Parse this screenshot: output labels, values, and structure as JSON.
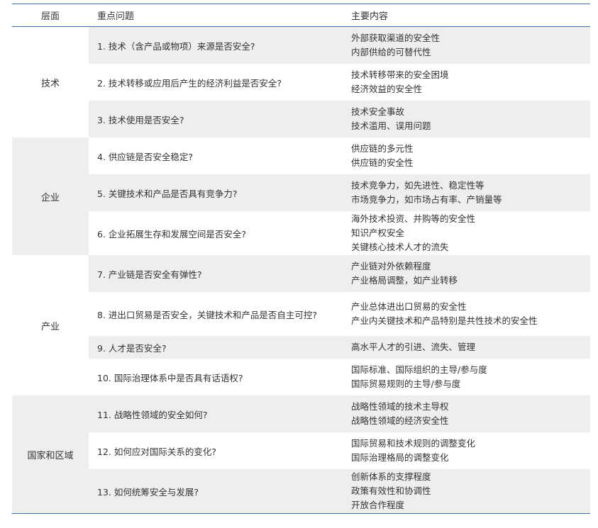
{
  "header": {
    "level": "层面",
    "question": "重点问题",
    "content": "主要内容"
  },
  "groups": [
    {
      "level": "技术",
      "rows": [
        {
          "q": "1. 技术（含产品或物项）来源是否安全?",
          "c": [
            "外部获取渠道的安全性",
            "内部供给的可替代性"
          ]
        },
        {
          "q": "2. 技术转移或应用后产生的经济利益是否安全?",
          "c": [
            "技术转移带来的安全困境",
            "经济效益的安全性"
          ]
        },
        {
          "q": "3. 技术使用是否安全?",
          "c": [
            "技术安全事故",
            "技术滥用、误用问题"
          ]
        }
      ]
    },
    {
      "level": "企业",
      "rows": [
        {
          "q": "4. 供应链是否安全稳定?",
          "c": [
            "供应链的多元性",
            "供应链的安全性"
          ]
        },
        {
          "q": "5. 关键技术和产品是否具有竞争力?",
          "c": [
            "技术竞争力，如先进性、稳定性等",
            "市场竞争力，如市场占有率、产销量等"
          ]
        },
        {
          "q": "6. 企业拓展生存和发展空间是否安全?",
          "c": [
            "海外技术投资、并购等的安全性",
            "知识产权安全",
            "关键核心技术人才的流失"
          ]
        }
      ]
    },
    {
      "level": "产业",
      "rows": [
        {
          "q": "7. 产业链是否安全有弹性?",
          "c": [
            "产业链对外依赖程度",
            "产业格局调整，如产业转移"
          ]
        },
        {
          "q": "8. 进出口贸易是否安全，关键技术和产品是否自主可控?",
          "c": [
            "产业总体进出口贸易的安全性",
            "产业内关键技术和产品特别是共性技术的安全性"
          ]
        },
        {
          "q": "9. 人才是否安全?",
          "c": [
            "高水平人才的引进、流失、管理"
          ]
        },
        {
          "q": "10. 国际治理体系中是否具有话语权?",
          "c": [
            "国际标准、国际组织的主导/参与度",
            "国际贸易规则的主导/参与度"
          ]
        }
      ]
    },
    {
      "level": "国家和区域",
      "rows": [
        {
          "q": "11. 战略性领域的安全如何?",
          "c": [
            "战略性领域的技术主导权",
            "战略性领域的经济安全性"
          ]
        },
        {
          "q": "12. 如何应对国际关系的变化?",
          "c": [
            "国际贸易和技术规则的调整变化",
            "国际治理格局的调整变化"
          ]
        },
        {
          "q": "13. 如何统筹安全与发展?",
          "c": [
            "创新体系的支撑程度",
            "政策有效性和协调性",
            "开放合作程度"
          ]
        }
      ]
    }
  ]
}
